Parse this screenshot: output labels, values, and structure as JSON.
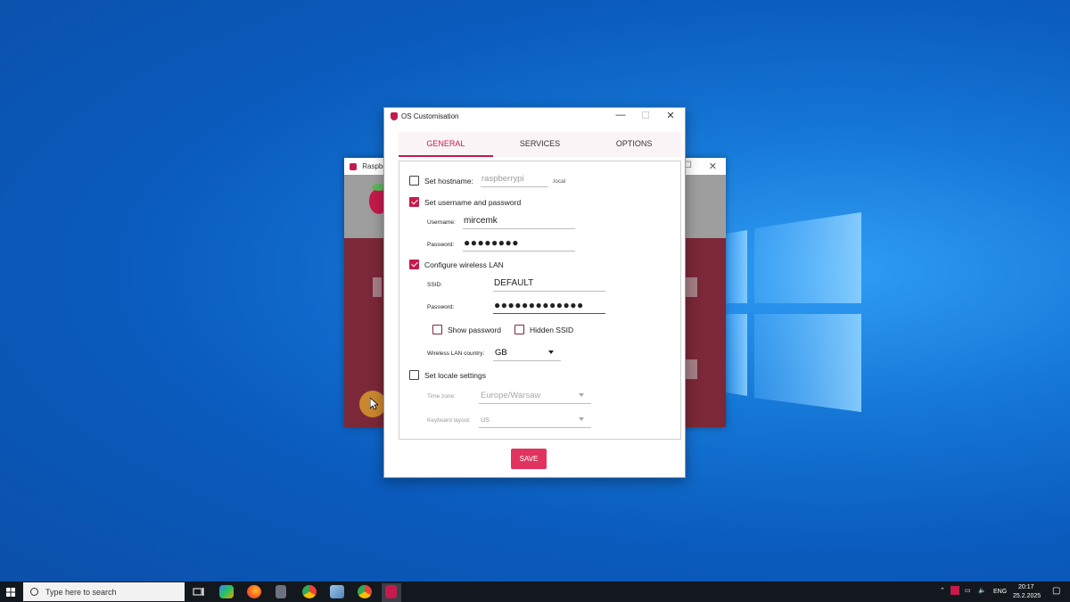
{
  "background_window": {
    "title": "Raspberry"
  },
  "dialog": {
    "title": "OS Customisation",
    "buttons": {
      "minimize": "—",
      "maximize": "☐",
      "close": "✕"
    },
    "tabs": [
      {
        "label": "GENERAL",
        "active": true
      },
      {
        "label": "SERVICES",
        "active": false
      },
      {
        "label": "OPTIONS",
        "active": false
      }
    ],
    "hostname": {
      "label": "Set hostname:",
      "checked": false,
      "placeholder": "raspberrypi",
      "suffix": ".local"
    },
    "user": {
      "label": "Set username and password",
      "checked": true,
      "username_label": "Username:",
      "username_value": "mircemk",
      "password_label": "Password:",
      "password_value": "●●●●●●●●"
    },
    "wlan": {
      "label": "Configure wireless LAN",
      "checked": true,
      "ssid_label": "SSID:",
      "ssid_value": "DEFAULT",
      "password_label": "Password:",
      "password_value": "●●●●●●●●●●●●●",
      "show_password_label": "Show password",
      "show_password_checked": false,
      "hidden_ssid_label": "Hidden SSID",
      "hidden_ssid_checked": false,
      "country_label": "Wireless LAN country:",
      "country_value": "GB"
    },
    "locale": {
      "label": "Set locale settings",
      "checked": false,
      "timezone_label": "Time zone:",
      "timezone_value": "Europe/Warsaw",
      "keyboard_label": "Keyboard layout:",
      "keyboard_value": "us"
    },
    "save_label": "SAVE"
  },
  "taskbar": {
    "search_placeholder": "Type here to search",
    "language": "ENG",
    "time": "20:17",
    "date": "25.2.2025"
  },
  "colors": {
    "accent": "#c51a4a",
    "save": "#e0345f",
    "taskbar": "#13181f"
  }
}
